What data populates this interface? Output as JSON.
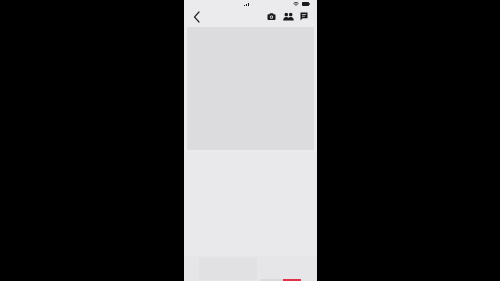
{
  "colors": {
    "background": "#000000",
    "screen": "#ebeaec",
    "placeholder": "#dcdbdd",
    "icon": "#1a1a1a",
    "accent": "#e0314b"
  },
  "icons": {
    "back": "chevron-left-icon",
    "camera": "camera-icon",
    "people": "people-icon",
    "chat": "chat-icon",
    "signal": "signal-icon",
    "wifi": "wifi-icon",
    "battery": "battery-icon"
  }
}
